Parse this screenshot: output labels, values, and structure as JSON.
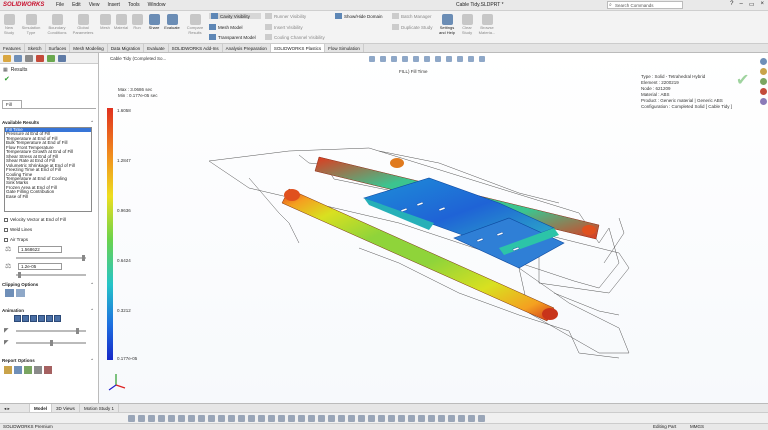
{
  "app": {
    "brand": "SOLIDWORKS",
    "document_title": "Cable Tidy.SLDPRT *",
    "search_placeholder": "Search Commands"
  },
  "menu": [
    "File",
    "Edit",
    "View",
    "Insert",
    "Tools",
    "Window"
  ],
  "ribbon": {
    "buttons": [
      {
        "label": "New Study",
        "active": false
      },
      {
        "label": "Simulation Type",
        "active": false
      },
      {
        "label": "Boundary Conditions",
        "active": false
      },
      {
        "label": "Global Parameters",
        "active": false
      },
      {
        "label": "Mesh",
        "active": false
      },
      {
        "label": "Material",
        "active": false
      },
      {
        "label": "Run",
        "active": false
      },
      {
        "label": "Share",
        "active": true
      },
      {
        "label": "Evaluate",
        "active": true
      },
      {
        "label": "Compare Results",
        "active": false
      }
    ],
    "visibility": [
      "Cavity Visibility",
      "Mesh Model",
      "Transparent Model"
    ],
    "visibility_gray": [
      "Runner Visibility",
      "Insert Visibility",
      "Cooling Channel Visibility"
    ],
    "show_hide": "Show/Hide Domain",
    "batch": [
      "Batch Manager",
      "Duplicate Study"
    ],
    "right_buttons": [
      "Settings and Help",
      "Clear Study",
      "Browse Materia..."
    ]
  },
  "tabs": [
    "Features",
    "Sketch",
    "Surfaces",
    "Mesh Modeling",
    "Data Migration",
    "Evaluate",
    "SOLIDWORKS Add-Ins",
    "Analysis Preparation",
    "SOLIDWORKS Plastics",
    "Flow Simulation"
  ],
  "active_tab": "SOLIDWORKS Plastics",
  "panel": {
    "title": "Results",
    "fill_tab": "Fill",
    "available_results_label": "Available Results",
    "results": [
      "Fill Time",
      "Pressure at End of Fill",
      "Temperature at End of Fill",
      "Bulk Temperature at End of Fill",
      "Flow Front Temperature",
      "Temperature Growth at End of Fill",
      "Shear Stress at End of Fill",
      "Shear Rate at End of Fill",
      "Volumetric Shrinkage at End of Fill",
      "Freezing Time at End of Fill",
      "Cooling Time",
      "Temperature at End of Cooling",
      "Sink Marks",
      "Frozen Area at End of Fill",
      "Gate Filling Contribution",
      "Ease of Fill"
    ],
    "selected_result": "Fill Time",
    "velocity_vector": "Velocity Vector at End of Fill",
    "weld_lines": "Weld Lines",
    "air_traps": "Air Traps",
    "spin1": "1.568622",
    "spin2": "1.2e-05",
    "clipping_options": "Clipping Options",
    "animation": "Animation",
    "report_options": "Report Options"
  },
  "viewport": {
    "breadcrumb": "Cable Tidy (Completed So...",
    "view_title": "FILL) Fill Time",
    "max_label": "Max : 3.0686 sec",
    "min_label": "Min : 0.177e-05 sec",
    "legend_ticks": [
      "1.6058",
      "1.2847",
      "0.9636",
      "0.6424",
      "0.3212",
      "0.177e-05"
    ],
    "info": [
      "Type : Solid - Tetrahedral Hybrid",
      "Element : 2200219",
      "Node : 621209",
      "Material : ABS",
      "Product : Generic material | Generic ABS",
      "Configuration : Completed Solid [ Cable Tidy ]"
    ]
  },
  "bottom_tabs": [
    "Model",
    "3D Views",
    "Motion Study 1"
  ],
  "active_bottom_tab": "Model",
  "status": {
    "left": "SOLIDWORKS Premium",
    "mode": "Editing Part",
    "units": "MMGS"
  },
  "colors": {
    "accent": "#3875d7",
    "brand": "#c8102e"
  }
}
